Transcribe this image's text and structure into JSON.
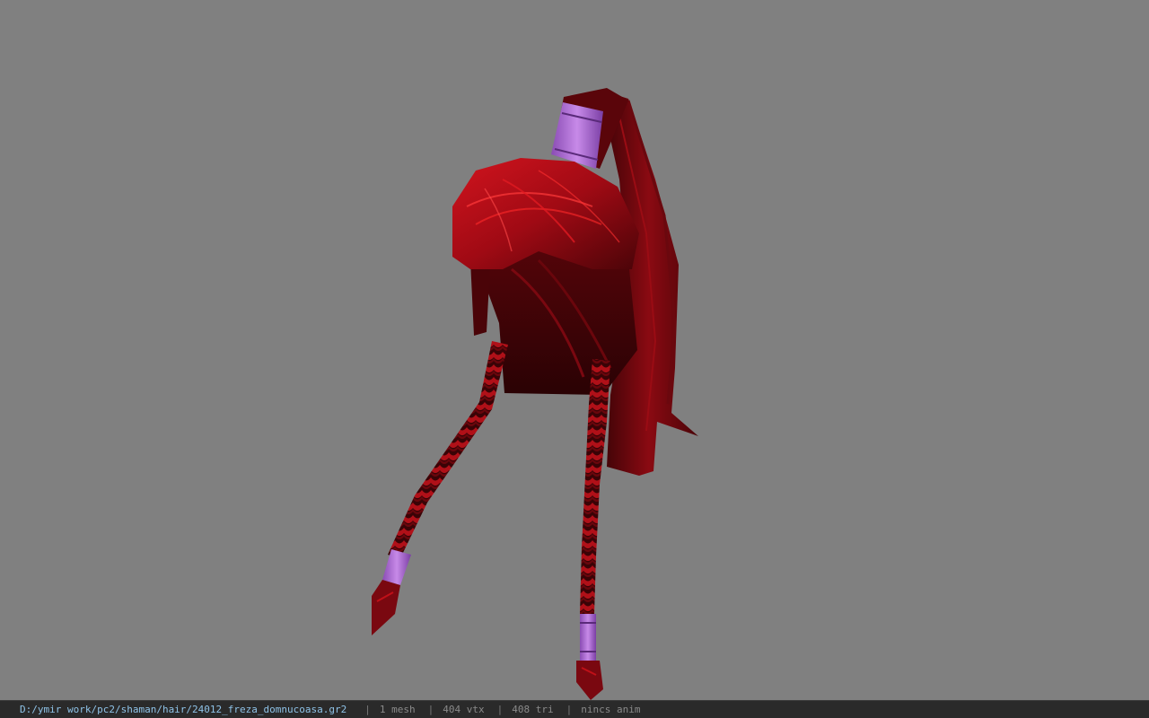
{
  "status": {
    "file_path": "D:/ymir work/pc2/shaman/hair/24012_freza_domnucoasa.gr2",
    "separator": "|",
    "mesh_count": "1 mesh",
    "vertex_count": "404 vtx",
    "triangle_count": "408 tri",
    "animation": "nincs anim"
  },
  "colors": {
    "background": "#808080",
    "status_bar": "#2a2a2a",
    "path_text": "#8fc3e8",
    "hair_red": "#c0101a",
    "hair_dark": "#3a0306",
    "band_purple": "#b070d8"
  },
  "viewport": {
    "model_icon": "hair-model"
  }
}
